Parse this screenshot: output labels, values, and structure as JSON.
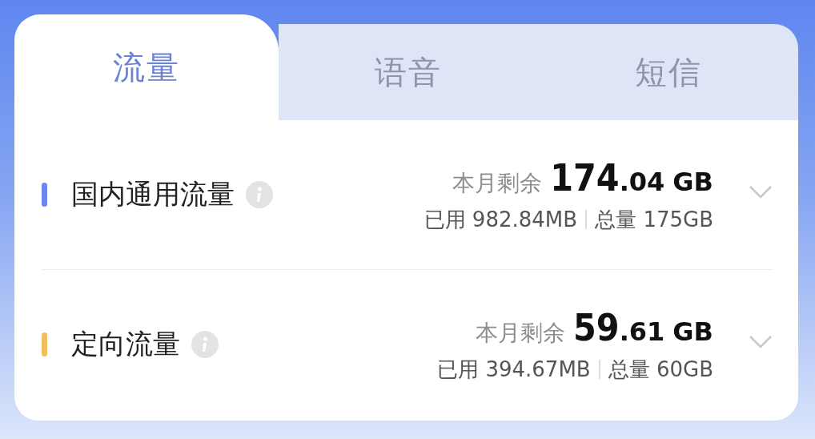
{
  "tabs": [
    {
      "label": "流量",
      "selected": true
    },
    {
      "label": "语音",
      "selected": false
    },
    {
      "label": "短信",
      "selected": false
    }
  ],
  "items": [
    {
      "name": "国内通用流量",
      "color": "#6b86ee",
      "remaining_label": "本月剩余",
      "remaining_int": "174",
      "remaining_dec": ".04",
      "remaining_unit": "GB",
      "used": "已用 982.84MB",
      "total": "总量 175GB",
      "expanded": false
    },
    {
      "name": "定向流量",
      "color": "#f0bf5c",
      "remaining_label": "本月剩余",
      "remaining_int": "59",
      "remaining_dec": ".61",
      "remaining_unit": "GB",
      "used": "已用 394.67MB",
      "total": "总量 60GB",
      "expanded": false
    }
  ]
}
